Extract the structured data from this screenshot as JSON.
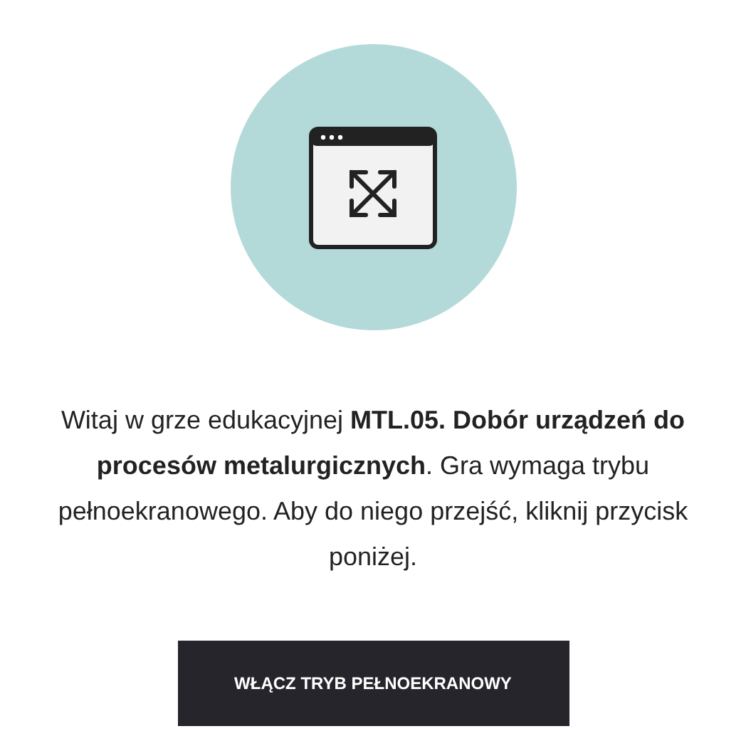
{
  "intro": "Witaj w grze edukacyjnej **MTL.05. Dobór urządzeń do procesów metalurgicznych**. Gra wymaga trybu pełnoekranowego. Aby do niego przejść, kliknij przycisk poniżej.",
  "button": "WŁĄCZ TRYB PEŁNOEKRANOWY"
}
